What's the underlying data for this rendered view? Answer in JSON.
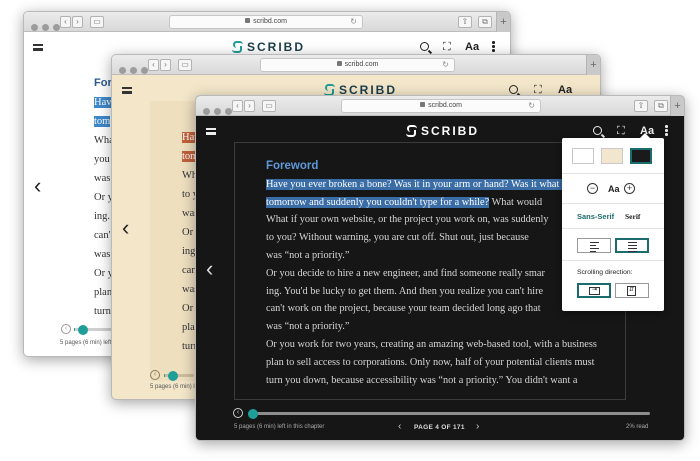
{
  "browser": {
    "url": "scribd.com"
  },
  "brand": {
    "name": "SCRIBD",
    "teal": "#1e9e98",
    "dark_bg": "#161616",
    "sepia_bg": "#f3e6c9"
  },
  "toolbar": {
    "font_size_label": "Aa"
  },
  "book": {
    "heading": "Foreword",
    "heading_fragment": "Fore",
    "highlight_1": "Have you ever broken a bone? Was it in your arm or hand? Was it what if",
    "highlight_2": "tomorrow and suddenly you couldn't type for a while?",
    "line_1_tail": " What would",
    "line_2": "What if your own website, or the project you work on, was suddenly",
    "line_3": "to you? Without warning, you are cut off. Shut out, just because",
    "line_4": "was “not a priority.”",
    "line_5": "Or you decide to hire a new engineer, and find someone really smar",
    "line_6": "ing. You'd be lucky to get them. And then you realize you can't hire",
    "line_7": "can't work on the project, because your team decided long ago that",
    "line_8": "was “not a priority.”",
    "line_9": "Or you work for two years, creating an amazing web-based tool, with a business",
    "line_10": "plan to sell access to corporations. Only now, half of your potential clients must",
    "line_11": "turn you down, because accessibility was “not a priority.” You didn't want a"
  },
  "back_window_fragments": [
    "What",
    "you",
    "was",
    "Or y",
    "ing.",
    "can'",
    "was",
    "Or y",
    "plan",
    "turn"
  ],
  "mid_window_fragments": [
    "Wha",
    "to y",
    "was",
    "Or y",
    "ing.",
    "can'",
    "was",
    "Or y",
    "plan",
    "turn"
  ],
  "back_highlight_fragments": [
    "Hav",
    "tom"
  ],
  "mid_highlight_fragments": [
    "Hav",
    "tom"
  ],
  "footer": {
    "pages_left": "5 pages (6 min) left in this chapter",
    "pages_left_short": "5 pages (6 min) left",
    "pages_left_mid": "5 pages (6 min) l",
    "page_indicator": "PAGE 4 OF 171",
    "percent_read": "2% read",
    "progress_fraction": 0.02
  },
  "settings": {
    "themes": [
      {
        "name": "white",
        "color": "#ffffff"
      },
      {
        "name": "sepia",
        "color": "#f3e6cf"
      },
      {
        "name": "dark",
        "color": "#1a1a1a",
        "selected": true
      }
    ],
    "font_size_label": "Aa",
    "font_sans": "Sans-Serif",
    "font_serif": "Serif",
    "scrolling_label": "Scrolling direction:"
  }
}
